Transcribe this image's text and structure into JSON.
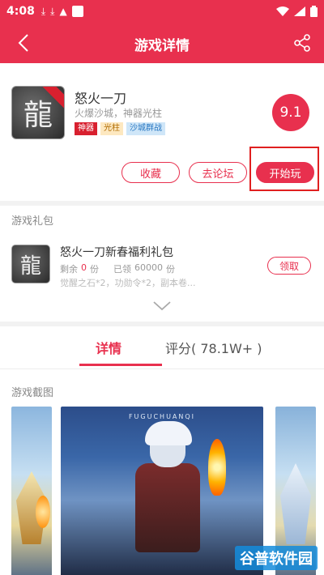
{
  "status_bar": {
    "time": "4:08"
  },
  "header": {
    "title": "游戏详情"
  },
  "game": {
    "icon_glyph": "龍",
    "name": "怒火一刀",
    "desc": "火爆沙城，神器光柱",
    "tags": [
      "神器",
      "光柱",
      "沙城群战"
    ],
    "score": "9.1"
  },
  "actions": {
    "collect": "收藏",
    "forum": "去论坛",
    "play": "开始玩"
  },
  "gift_section": {
    "label": "游戏礼包",
    "item": {
      "icon_glyph": "龍",
      "title": "怒火一刀新春福利礼包",
      "remain_label": "剩余",
      "remain_value": "0",
      "remain_unit": "份",
      "claimed_label": "已领",
      "claimed_value": "60000",
      "claimed_unit": "份",
      "desc": "觉醒之石*2，功勋令*2，副本卷...",
      "claim_label": "领取"
    }
  },
  "tabs": {
    "detail": "详情",
    "rating": "评分( 78.1W+ )"
  },
  "screenshots": {
    "label": "游戏截图",
    "caption": "FUGUCHUANQI"
  },
  "watermark": "谷普软件园"
}
